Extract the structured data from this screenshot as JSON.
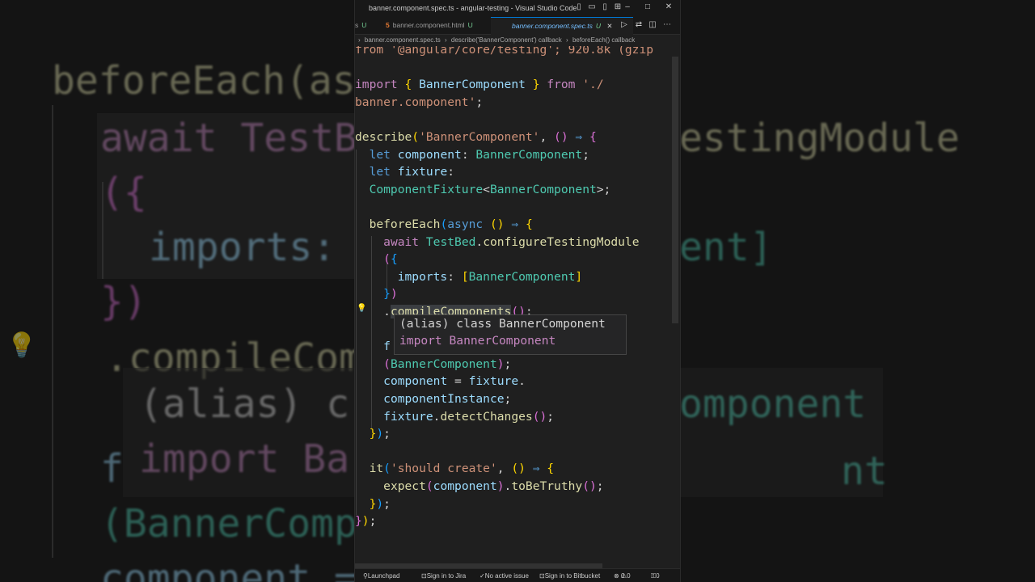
{
  "window": {
    "title": "banner.component.spec.ts - angular-testing - Visual Studio Code"
  },
  "tabs": [
    {
      "label": "s",
      "status": "U"
    },
    {
      "label": "banner.component.html",
      "status": "U"
    },
    {
      "label": "banner.component.spec.ts",
      "status": "U"
    }
  ],
  "breadcrumb": {
    "file": "banner.component.spec.ts",
    "describe": "describe('BannerComponent') callback",
    "before_each": "beforeEach() callback"
  },
  "editor": {
    "import_line_partial": "from '@angular/core/testing'; 920.8k (gzip",
    "lines": [
      "import { BannerComponent } from './",
      "banner.component';",
      "",
      "describe('BannerComponent', () => {",
      "  let component: BannerComponent;",
      "  let fixture:",
      "  ComponentFixture<BannerComponent>;",
      "",
      "  beforeEach(async () => {",
      "    await TestBed.configureTestingModule",
      "    ({",
      "      imports: [BannerComponent]",
      "    })",
      "    .compileComponents();",
      "",
      "    fixture = TestBed.createComponent",
      "    (BannerComponent);",
      "    component = fixture.",
      "    componentInstance;",
      "    fixture.detectChanges();",
      "  });",
      "",
      "  it('should create', () => {",
      "    expect(component).toBeTruthy();",
      "  });",
      "});"
    ]
  },
  "hover": {
    "line1": "(alias) class BannerComponent",
    "line2": "import BannerComponent"
  },
  "statusbar": {
    "launchpad": "Launchpad",
    "jira": "Sign in to Jira",
    "issue": "No active issue",
    "bitbucket": "Sign in to Bitbucket",
    "errors": "0",
    "warnings": "0",
    "ports": "0"
  },
  "background_zoom": {
    "l1": "beforeEach(as",
    "l2": "await TestB",
    "l2b": "estingModule",
    "l3": "({",
    "l4": "imports: [",
    "l4b": "ent]",
    "l5": "})",
    "l6": ".compileCom",
    "l7": "(alias) c",
    "l7b": "omponent",
    "l8": "import Ba",
    "l8b": "nt",
    "l9": "f",
    "l10": "(BannerComp",
    "l11": "component ="
  }
}
